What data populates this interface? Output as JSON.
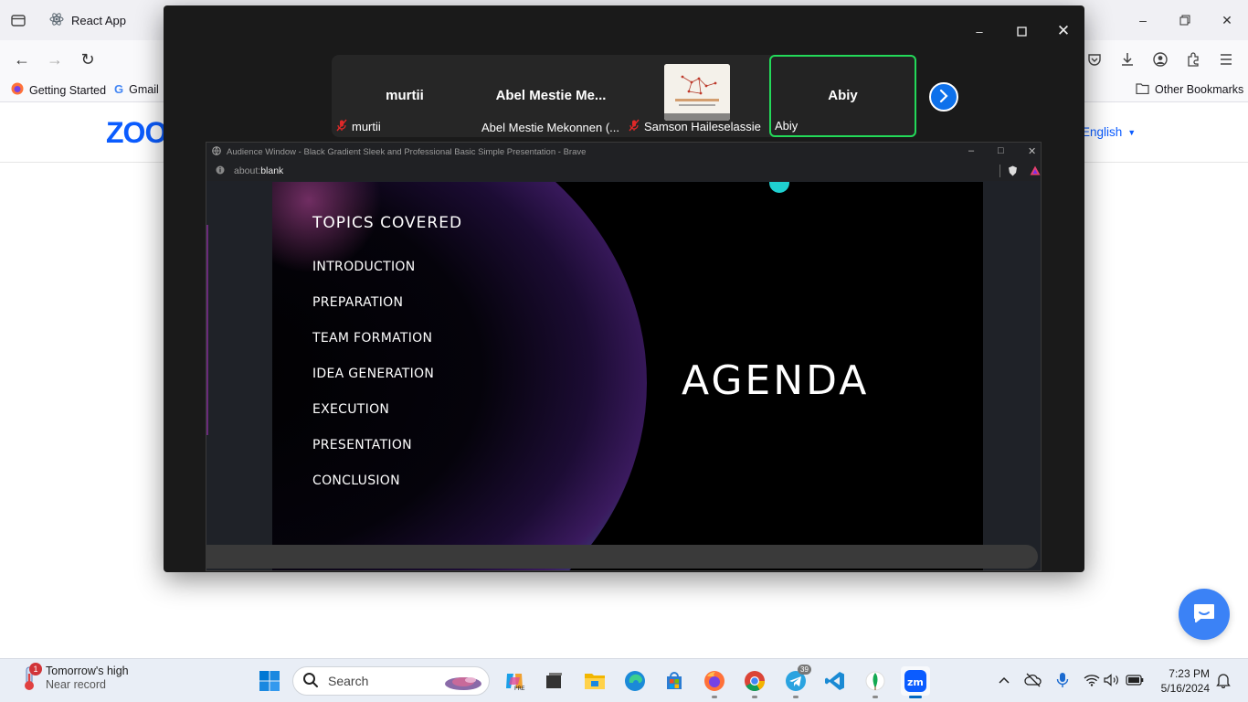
{
  "browser": {
    "tab_title": "React App",
    "bookmarks": [
      {
        "label": "Getting Started"
      },
      {
        "label": "Gmail"
      }
    ],
    "other_bookmarks": "Other Bookmarks"
  },
  "page": {
    "logo": "ZOO",
    "language": "English"
  },
  "zoom": {
    "participants": [
      {
        "tile_name": "murtii",
        "label": "murtii",
        "muted": true
      },
      {
        "tile_name": "Abel  Mestie  Me...",
        "label": "Abel Mestie Mekonnen (...",
        "muted": false
      },
      {
        "tile_name": "",
        "label": "Samson Haileselassie",
        "muted": true
      },
      {
        "tile_name": "Abiy",
        "label": "Abiy",
        "muted": false
      }
    ]
  },
  "audience_window": {
    "title": "Audience Window - Black Gradient Sleek and Professional Basic Simple Presentation - Brave",
    "address_prefix": "about:",
    "address_host": "blank"
  },
  "slide": {
    "heading": "TOPICS COVERED",
    "topics": [
      "INTRODUCTION",
      "PREPARATION",
      "TEAM FORMATION",
      "IDEA GENERATION",
      "EXECUTION",
      "PRESENTATION",
      "CONCLUSION"
    ],
    "big_title": "AGENDA"
  },
  "taskbar": {
    "weather_main": "Tomorrow's high",
    "weather_sub": "Near record",
    "weather_badge": "1",
    "search_placeholder": "Search",
    "telegram_badge": "39",
    "time": "7:23 PM",
    "date": "5/16/2024"
  }
}
